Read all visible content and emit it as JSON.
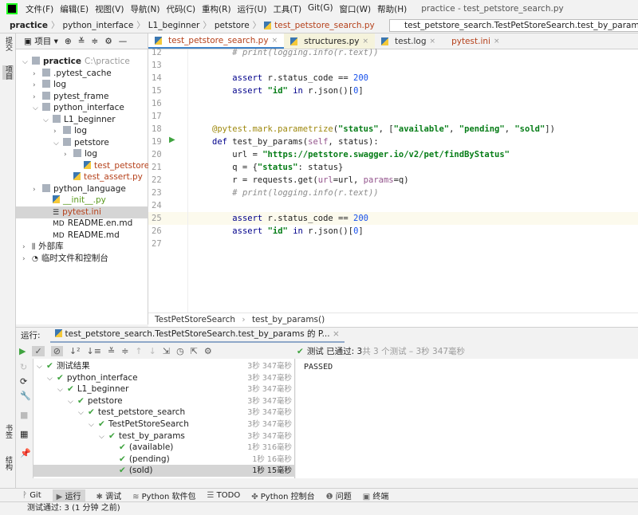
{
  "menu": {
    "items": [
      "文件(F)",
      "编辑(E)",
      "视图(V)",
      "导航(N)",
      "代码(C)",
      "重构(R)",
      "运行(U)",
      "工具(T)",
      "Git(G)",
      "窗口(W)",
      "帮助(H)"
    ],
    "window_title": "practice - test_petstore_search.py"
  },
  "breadcrumbs": [
    "practice",
    "python_interface",
    "L1_beginner",
    "petstore",
    "test_petstore_search.py"
  ],
  "run_config": "test_petstore_search.TestPetStoreSearch.test_by_params 的 Python 测试",
  "left_stripe": {
    "top": "提交",
    "project": "项目",
    "bookmarks": "书签",
    "structure": "结构"
  },
  "project": {
    "header": "项目",
    "tree": [
      {
        "label": "practice",
        "hint": "C:\\practice",
        "depth": 0,
        "arrow": "v",
        "type": "folder"
      },
      {
        "label": ".pytest_cache",
        "depth": 1,
        "arrow": ">",
        "type": "folder"
      },
      {
        "label": "log",
        "depth": 1,
        "arrow": ">",
        "type": "folder"
      },
      {
        "label": "pytest_frame",
        "depth": 1,
        "arrow": ">",
        "type": "folder"
      },
      {
        "label": "python_interface",
        "depth": 1,
        "arrow": "v",
        "type": "folder"
      },
      {
        "label": "L1_beginner",
        "depth": 2,
        "arrow": "v",
        "type": "folder"
      },
      {
        "label": "log",
        "depth": 3,
        "arrow": ">",
        "type": "folder"
      },
      {
        "label": "petstore",
        "depth": 3,
        "arrow": "v",
        "type": "folder"
      },
      {
        "label": "log",
        "depth": 4,
        "arrow": ">",
        "type": "folder"
      },
      {
        "label": "test_petstore_search.py",
        "depth": 5,
        "arrow": "",
        "type": "py",
        "color": "#b5401a"
      },
      {
        "label": "test_assert.py",
        "depth": 4,
        "arrow": "",
        "type": "py",
        "color": "#b5401a"
      },
      {
        "label": "python_language",
        "depth": 1,
        "arrow": ">",
        "type": "folder"
      },
      {
        "label": "__init__.py",
        "depth": 2,
        "arrow": "",
        "type": "py",
        "color": "#5a9a1e"
      },
      {
        "label": "pytest.ini",
        "depth": 2,
        "arrow": "",
        "type": "ini",
        "color": "#b5401a",
        "selected": true
      },
      {
        "label": "README.en.md",
        "depth": 2,
        "arrow": "",
        "type": "md"
      },
      {
        "label": "README.md",
        "depth": 2,
        "arrow": "",
        "type": "md"
      },
      {
        "label": "外部库",
        "depth": 0,
        "arrow": ">",
        "type": "lib"
      },
      {
        "label": "临时文件和控制台",
        "depth": 0,
        "arrow": ">",
        "type": "scratch"
      }
    ]
  },
  "editor": {
    "tabs": [
      {
        "label": "test_petstore_search.py",
        "active": true
      },
      {
        "label": "structures.py",
        "highlight": true
      },
      {
        "label": "test.log"
      },
      {
        "label": "pytest.ini"
      }
    ],
    "lines": [
      {
        "n": "12",
        "html": "    <span class='cm'># print(logging.info(r.text))</span>"
      },
      {
        "n": "13",
        "html": ""
      },
      {
        "n": "14",
        "html": "    <span class='kw'>assert</span> r.status_code == <span class='num'>200</span>"
      },
      {
        "n": "15",
        "html": "    <span class='kw'>assert</span> <span class='str'>\"id\"</span> <span class='kw'>in</span> r.json()[<span class='num'>0</span>]"
      },
      {
        "n": "16",
        "html": ""
      },
      {
        "n": "17",
        "html": ""
      },
      {
        "n": "18",
        "html": "<span class='dec'>@pytest.mark.parametrize</span>(<span class='str'>\"status\"</span>, [<span class='str'>\"available\"</span>, <span class='str'>\"pending\"</span>, <span class='str'>\"sold\"</span>])"
      },
      {
        "n": "19",
        "html": "<span class='kw'>def</span> test_by_params(<span class='self'>self</span>, status):"
      },
      {
        "n": "20",
        "html": "    url = <span class='str'>\"https://petstore.swagger.io/v2/pet/findByStatus\"</span>"
      },
      {
        "n": "21",
        "html": "    q = {<span class='str'>\"status\"</span>: status}"
      },
      {
        "n": "22",
        "html": "    r = requests.get(<span class='self'>url</span>=url, <span class='self'>params</span>=q)"
      },
      {
        "n": "23",
        "html": "    <span class='cm'># print(logging.info(r.text))</span>"
      },
      {
        "n": "24",
        "html": ""
      },
      {
        "n": "25",
        "html": "    <span class='kw'>assert</span> r.status_code == <span class='num'>200</span>",
        "current": true
      },
      {
        "n": "26",
        "html": "    <span class='kw'>assert</span> <span class='str'>\"id\"</span> <span class='kw'>in</span> r.json()[<span class='num'>0</span>]"
      },
      {
        "n": "27",
        "html": ""
      }
    ],
    "nav": [
      "TestPetStoreSearch",
      "test_by_params()"
    ]
  },
  "run": {
    "label": "运行:",
    "tab": "test_petstore_search.TestPetStoreSearch.test_by_params 的 P...",
    "summary_prefix": "测试 已通过: 3",
    "summary_rest": "共 3 个测试 – 3秒 347毫秒",
    "tree": [
      {
        "label": "测试结果",
        "depth": 0,
        "dur": "3秒 347毫秒",
        "arrow": "v"
      },
      {
        "label": "python_interface",
        "depth": 1,
        "dur": "3秒 347毫秒",
        "arrow": "v"
      },
      {
        "label": "L1_beginner",
        "depth": 2,
        "dur": "3秒 347毫秒",
        "arrow": "v"
      },
      {
        "label": "petstore",
        "depth": 3,
        "dur": "3秒 347毫秒",
        "arrow": "v"
      },
      {
        "label": "test_petstore_search",
        "depth": 4,
        "dur": "3秒 347毫秒",
        "arrow": "v"
      },
      {
        "label": "TestPetStoreSearch",
        "depth": 5,
        "dur": "3秒 347毫秒",
        "arrow": "v"
      },
      {
        "label": "test_by_params",
        "depth": 6,
        "dur": "3秒 347毫秒",
        "arrow": "v"
      },
      {
        "label": "(available)",
        "depth": 7,
        "dur": "1秒 316毫秒",
        "arrow": ""
      },
      {
        "label": "(pending)",
        "depth": 7,
        "dur": "1秒 16毫秒",
        "arrow": ""
      },
      {
        "label": "(sold)",
        "depth": 7,
        "dur": "1秒 15毫秒",
        "arrow": "",
        "selected": true
      }
    ],
    "output": "PASSED"
  },
  "bottom_tools": [
    {
      "label": "Git",
      "icon": "git-icon"
    },
    {
      "label": "运行",
      "icon": "run-icon",
      "active": true
    },
    {
      "label": "调试",
      "icon": "debug-icon"
    },
    {
      "label": "Python 软件包",
      "icon": "packages-icon"
    },
    {
      "label": "TODO",
      "icon": "todo-icon"
    },
    {
      "label": "Python 控制台",
      "icon": "python-console-icon"
    },
    {
      "label": "问题",
      "icon": "problems-icon"
    },
    {
      "label": "终端",
      "icon": "terminal-icon"
    }
  ],
  "status": "测试通过: 3 (1 分钟 之前)",
  "colors": {
    "accent": "#4083c9",
    "pass": "#3fa33f",
    "selection": "#d5d5d5"
  }
}
